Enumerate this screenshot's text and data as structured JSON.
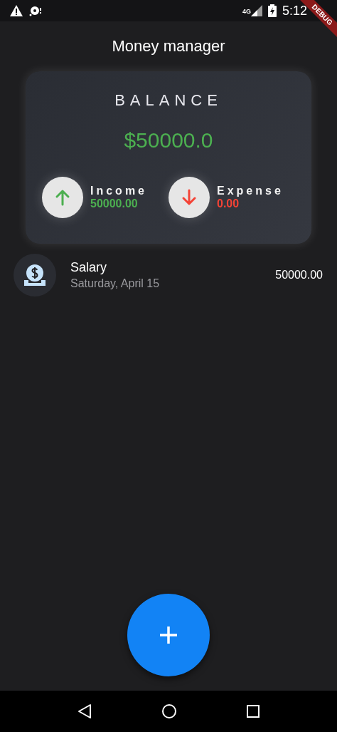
{
  "status_bar": {
    "network": "4G",
    "time": "5:12"
  },
  "debug_banner": "DEBUG",
  "app_bar": {
    "title": "Money manager"
  },
  "balance_card": {
    "label": "BALANCE",
    "amount": "$50000.0",
    "summary": [
      {
        "kind": "income",
        "label": "Income",
        "value": "50000.00"
      },
      {
        "kind": "expense",
        "label": "Expense",
        "value": "0.00"
      }
    ]
  },
  "transactions": [
    {
      "title": "Salary",
      "date": "Saturday, April 15",
      "amount": "50000.00"
    }
  ]
}
